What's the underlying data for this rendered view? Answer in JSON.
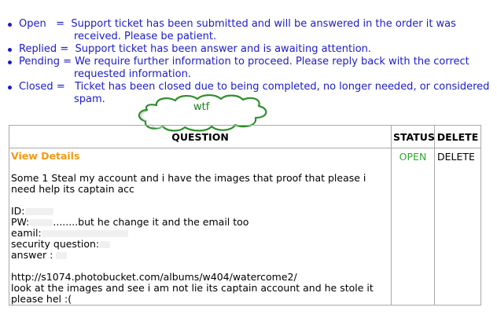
{
  "legend": [
    {
      "term": "Open",
      "sep": "=",
      "line1": "Support ticket has been submitted and will be answered in the order it was",
      "line2": "received. Please be patient."
    },
    {
      "term": "Replied",
      "sep": "=",
      "line1": "Support ticket has been answer and is awaiting attention.",
      "line2": ""
    },
    {
      "term": "Pending",
      "sep": "=",
      "line1": "We require further information to proceed. Please reply back with the correct",
      "line2": "requested information."
    },
    {
      "term": "Closed",
      "sep": "=",
      "line1": "Ticket has been closed due to being completed, no longer needed, or considered",
      "line2": "spam."
    }
  ],
  "annotation": {
    "text": "wtf"
  },
  "table": {
    "headers": {
      "question": "QUESTION",
      "status": "STATUS",
      "delete": "DELETE"
    },
    "row": {
      "view_details": "View Details",
      "question_lines": [
        "Some 1 Steal my account and i have the images that proof that please i need help its captain acc",
        "ID:",
        "PW:",
        "........but he change it and the email too",
        "eamil:",
        "security question:",
        "answer :",
        "http://s1074.photobucket.com/albums/w404/watercome2/",
        "look at the images and see i am not lie its captain account and he stole it please hel :("
      ],
      "status": "OPEN",
      "delete": "DELETE"
    }
  },
  "colors": {
    "legend_text": "#1c1cc8",
    "view_details": "#f39a12",
    "status_open": "#2ea82e",
    "annotation_text": "#1a7f1a"
  }
}
